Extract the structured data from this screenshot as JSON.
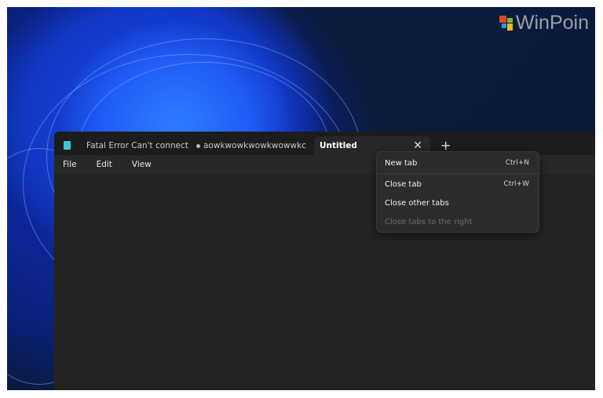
{
  "brand": {
    "logo_text": "WinPoin",
    "logo_colors": [
      "#e0472b",
      "#7bb934",
      "#1c9ce0",
      "#f6b91a"
    ]
  },
  "window": {
    "app_icon": "notepad-icon",
    "tabs": [
      {
        "label": "Fatal Error Can't connect",
        "unsaved": true
      },
      {
        "label": "aowkwowkwowkwowwkc",
        "unsaved": true
      },
      {
        "label": "Untitled",
        "active": true
      }
    ],
    "new_tab_icon": "plus-icon",
    "close_tab_icon": "close-icon",
    "menu": [
      "File",
      "Edit",
      "View"
    ]
  },
  "context_menu": {
    "items": [
      {
        "label": "New tab",
        "shortcut": "Ctrl+N",
        "enabled": true
      },
      {
        "label": "Close tab",
        "shortcut": "Ctrl+W",
        "enabled": true
      },
      {
        "label": "Close other tabs",
        "enabled": true
      },
      {
        "label": "Close tabs to the right",
        "enabled": false
      }
    ]
  }
}
